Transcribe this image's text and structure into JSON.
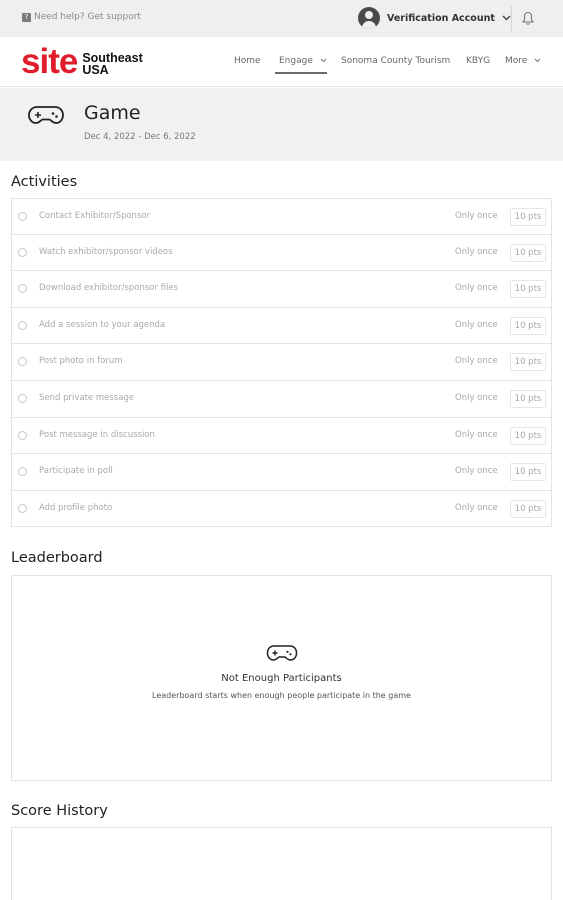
{
  "topbar": {
    "help_text": "Need help? Get support",
    "help_icon": "question-icon",
    "account_name": "Verification Account",
    "account_chevron": "chevron-down-icon",
    "bell_icon": "bell-icon"
  },
  "brand": {
    "logo_site": "site",
    "logo_line1": "Southeast",
    "logo_line2": "USA",
    "accent_color": "#e01e2b"
  },
  "nav": {
    "items": [
      {
        "label": "Home"
      },
      {
        "label": "Engage",
        "chevron": "⌄",
        "active": true
      },
      {
        "label": "Sonoma County Tourism"
      },
      {
        "label": "KBYG"
      },
      {
        "label": "More",
        "chevron": "⌄"
      }
    ]
  },
  "game": {
    "title": "Game",
    "dates": "Dec 4, 2022 - Dec 6, 2022",
    "icon": "gamepad-icon"
  },
  "activities": {
    "heading": "Activities",
    "rows": [
      {
        "label": "Contact Exhibitor/Sponsor",
        "frequency": "Only once",
        "points": "10 pts"
      },
      {
        "label": "Watch exhibitor/sponsor videos",
        "frequency": "Only once",
        "points": "10 pts"
      },
      {
        "label": "Download exhibitor/sponsor files",
        "frequency": "Only once",
        "points": "10 pts"
      },
      {
        "label": "Add a session to your agenda",
        "frequency": "Only once",
        "points": "10 pts"
      },
      {
        "label": "Post photo in forum",
        "frequency": "Only once",
        "points": "10 pts"
      },
      {
        "label": "Send private message",
        "frequency": "Only once",
        "points": "10 pts"
      },
      {
        "label": "Post message in discussion",
        "frequency": "Only once",
        "points": "10 pts"
      },
      {
        "label": "Participate in poll",
        "frequency": "Only once",
        "points": "10 pts"
      },
      {
        "label": "Add profile photo",
        "frequency": "Only once",
        "points": "10 pts"
      }
    ]
  },
  "leaderboard": {
    "heading": "Leaderboard",
    "empty_title": "Not Enough Participants",
    "empty_subtitle": "Leaderboard starts when enough people participate in the game",
    "icon": "gamepad-icon"
  },
  "score_history": {
    "heading": "Score History"
  }
}
